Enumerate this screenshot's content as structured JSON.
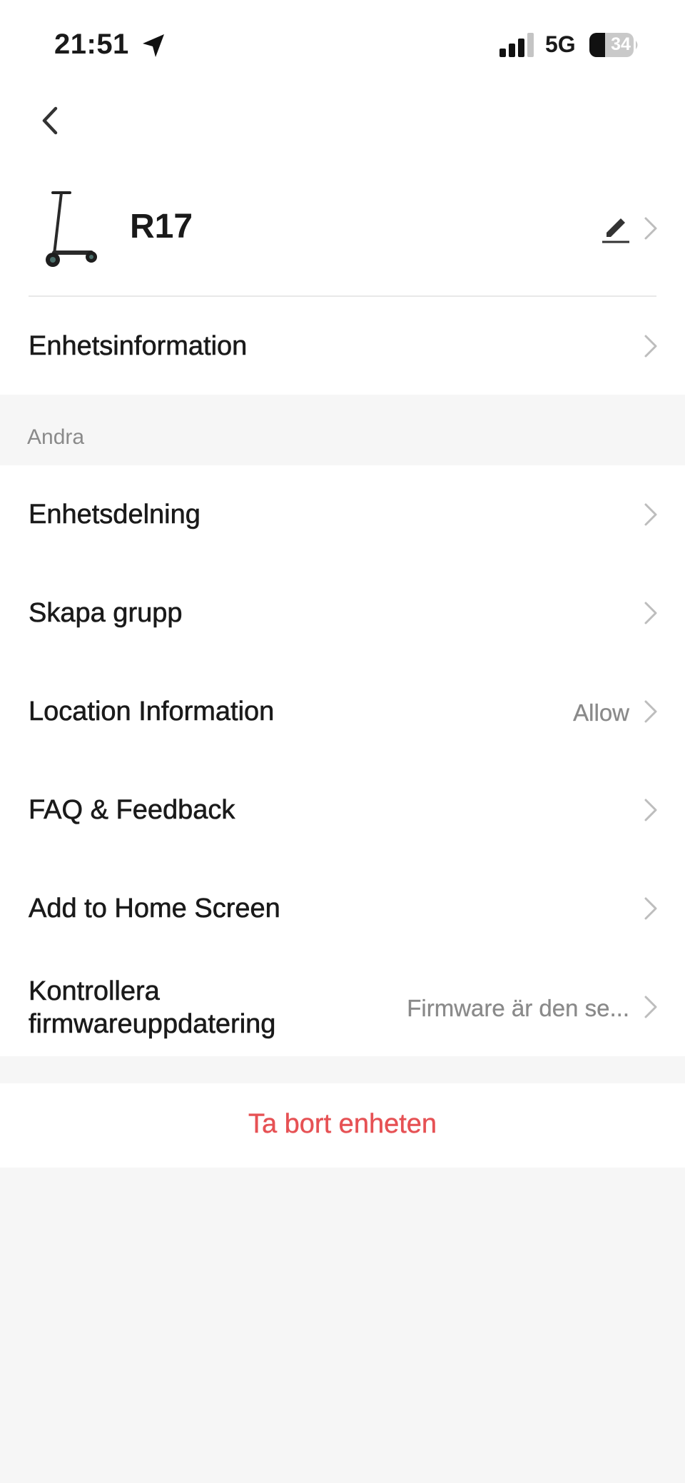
{
  "status_bar": {
    "time": "21:51",
    "network": "5G",
    "battery": "34",
    "icons": [
      "location-arrow-icon",
      "signal-icon",
      "battery-icon"
    ]
  },
  "header": {
    "back_icon": "chevron-left-icon",
    "device_name": "R17",
    "edit_icon": "pencil-icon"
  },
  "device_info": {
    "label": "Enhetsinformation"
  },
  "section": {
    "title": "Andra"
  },
  "rows": [
    {
      "label": "Enhetsdelning",
      "value": ""
    },
    {
      "label": "Skapa grupp",
      "value": ""
    },
    {
      "label": "Location Information",
      "value": "Allow"
    },
    {
      "label": "FAQ & Feedback",
      "value": ""
    },
    {
      "label": "Add to Home Screen",
      "value": ""
    },
    {
      "label_line1": "Kontrollera",
      "label_line2": "firmwareuppdatering",
      "value": "Firmware är den se..."
    }
  ],
  "delete": {
    "label": "Ta bort enheten"
  },
  "colors": {
    "background": "#f6f6f6",
    "danger": "#e65154",
    "muted": "#8a8a8a"
  }
}
